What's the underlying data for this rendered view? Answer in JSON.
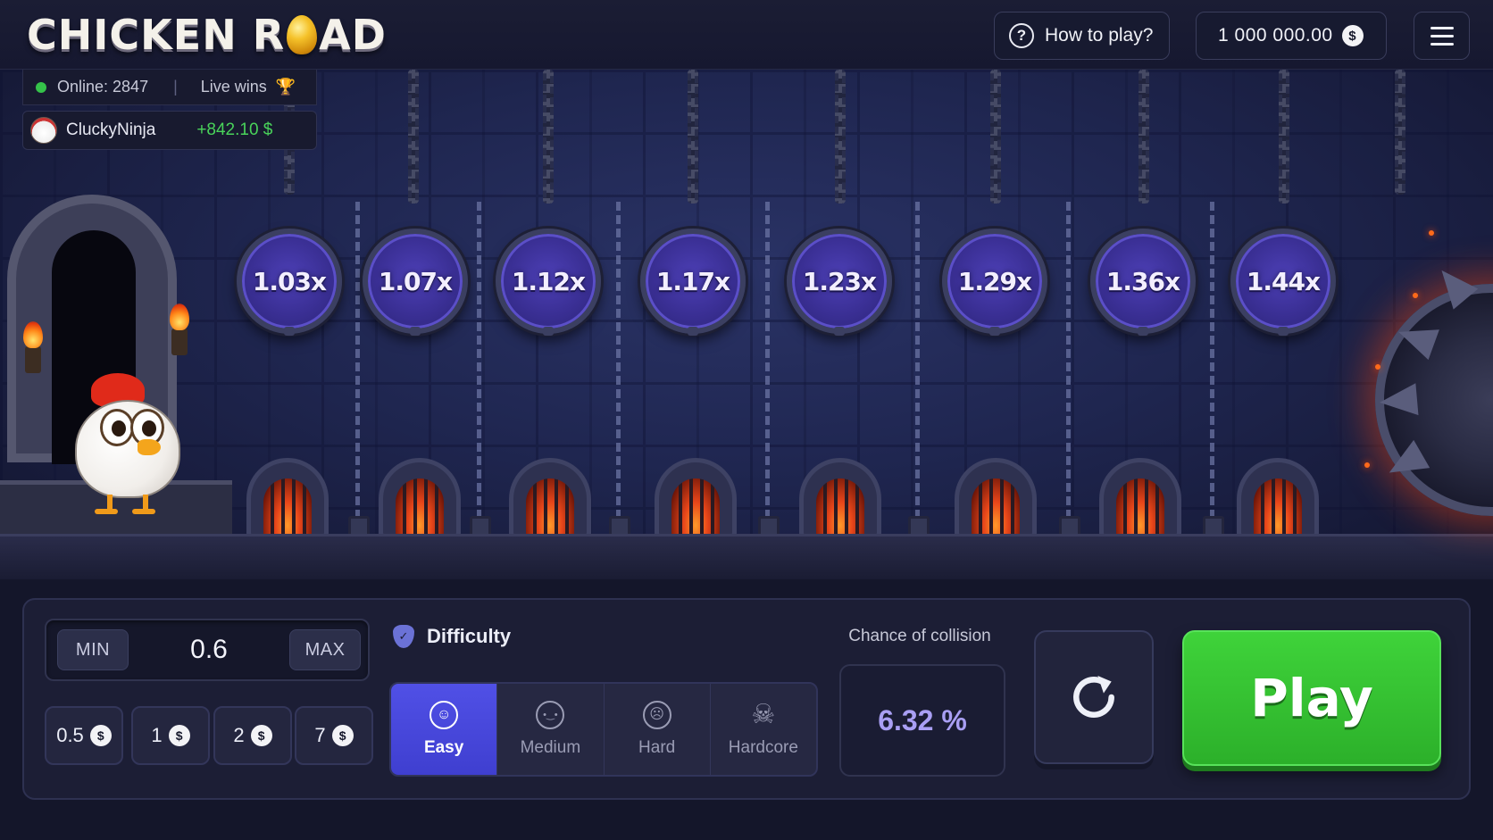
{
  "header": {
    "logo_left": "CHICKEN R",
    "logo_right": "AD",
    "how_to_play": "How to play?",
    "how_icon": "?",
    "balance": "1 000 000.00",
    "currency_symbol": "$"
  },
  "live": {
    "online_label": "Online: 2847",
    "separator": "|",
    "live_wins": "Live wins",
    "trophy_icon": "🏆",
    "winner_name": "CluckyNinja",
    "winner_amount": "+842.10 $"
  },
  "multipliers": [
    "1.03x",
    "1.07x",
    "1.12x",
    "1.17x",
    "1.23x",
    "1.29x",
    "1.36x",
    "1.44x"
  ],
  "bet": {
    "min_label": "MIN",
    "max_label": "MAX",
    "value": "0.6",
    "quick": [
      {
        "amount": "0.5",
        "symbol": "$"
      },
      {
        "amount": "1",
        "symbol": "$"
      },
      {
        "amount": "2",
        "symbol": "$"
      },
      {
        "amount": "7",
        "symbol": "$"
      }
    ]
  },
  "difficulty": {
    "title": "Difficulty",
    "selected": "Easy",
    "options": [
      {
        "label": "Easy",
        "icon": "smile-icon",
        "glyph": "☺"
      },
      {
        "label": "Medium",
        "icon": "neutral-face-icon",
        "glyph": "•‿•"
      },
      {
        "label": "Hard",
        "icon": "angry-face-icon",
        "glyph": "☹"
      },
      {
        "label": "Hardcore",
        "icon": "skull-icon",
        "glyph": "☠"
      }
    ]
  },
  "collision": {
    "label": "Chance of collision",
    "value": "6.32 %"
  },
  "actions": {
    "reload_icon": "refresh-icon",
    "play_label": "Play"
  },
  "colors": {
    "accent": "#4747dc",
    "play_green": "#35c232",
    "win_green": "#49d35a",
    "multiplier_purple": "#3a2f94"
  }
}
